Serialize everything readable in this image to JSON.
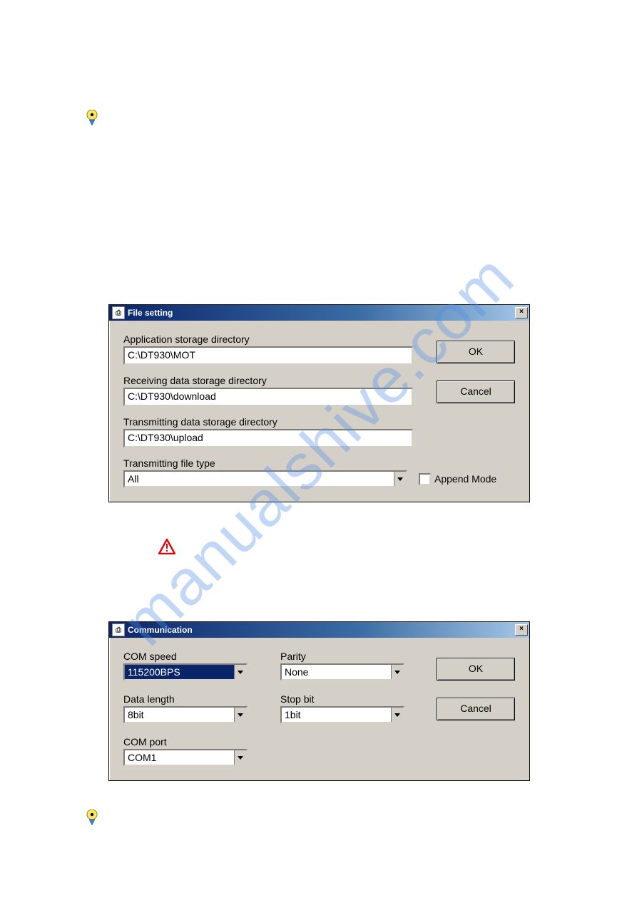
{
  "tip_icon_name": "tip-bulb-icon",
  "warn_icon_name": "warning-triangle-icon",
  "watermark": "manualshive.com",
  "dialog1": {
    "title": "File setting",
    "labels": {
      "app_dir": "Application storage directory",
      "recv_dir": "Receiving data storage directory",
      "trans_dir": "Transmitting data storage directory",
      "file_type": "Transmitting file type"
    },
    "values": {
      "app_dir": "C:\\DT930\\MOT",
      "recv_dir": "C:\\DT930\\download",
      "trans_dir": "C:\\DT930\\upload",
      "file_type": "All"
    },
    "append_mode_label": "Append Mode",
    "ok": "OK",
    "cancel": "Cancel"
  },
  "dialog2": {
    "title": "Communication",
    "labels": {
      "com_speed": "COM speed",
      "parity": "Parity",
      "data_length": "Data length",
      "stop_bit": "Stop bit",
      "com_port": "COM port"
    },
    "values": {
      "com_speed": "115200BPS",
      "parity": "None",
      "data_length": "8bit",
      "stop_bit": "1bit",
      "com_port": "COM1"
    },
    "ok": "OK",
    "cancel": "Cancel"
  }
}
